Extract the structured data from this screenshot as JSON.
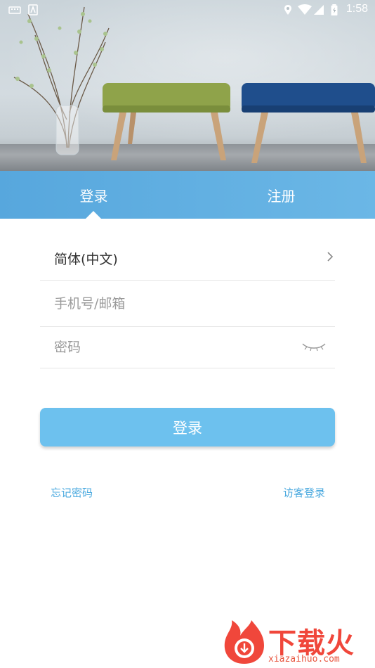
{
  "status_bar": {
    "time": "1:58",
    "icons": [
      "keyboard-icon",
      "accessibility-icon",
      "location-icon",
      "wifi-icon",
      "signal-icon",
      "battery-icon"
    ]
  },
  "tabs": [
    {
      "label": "登录",
      "active": true
    },
    {
      "label": "注册",
      "active": false
    }
  ],
  "form": {
    "language_label": "简体(中文)",
    "phone_placeholder": "手机号/邮箱",
    "password_placeholder": "密码"
  },
  "login_button": "登录",
  "links": {
    "forgot_password": "忘记密码",
    "guest_login": "访客登录"
  },
  "watermark": {
    "brand": "下载火",
    "url": "xiazaihuo.com"
  },
  "colors": {
    "accent": "#6dc1ee",
    "tab_bar": "#5aaade",
    "link": "#4aa9df",
    "watermark": "#f0473b"
  }
}
